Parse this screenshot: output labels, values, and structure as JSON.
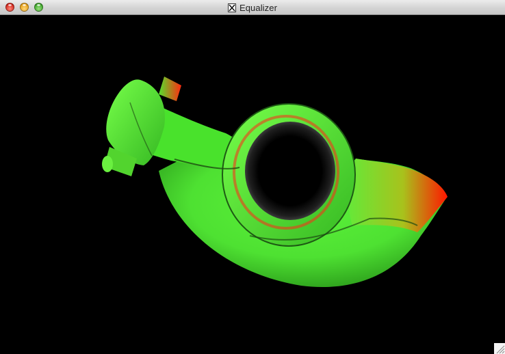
{
  "window": {
    "title": "Equalizer",
    "title_icon": "x11-icon"
  },
  "controls": {
    "close": "close-button",
    "minimize": "minimize-button",
    "zoom": "zoom-button"
  },
  "render": {
    "model": "rocker-arm",
    "background_color": "#000000",
    "primary_color": "#44ee2e",
    "accent_color": "#ff1a00"
  }
}
